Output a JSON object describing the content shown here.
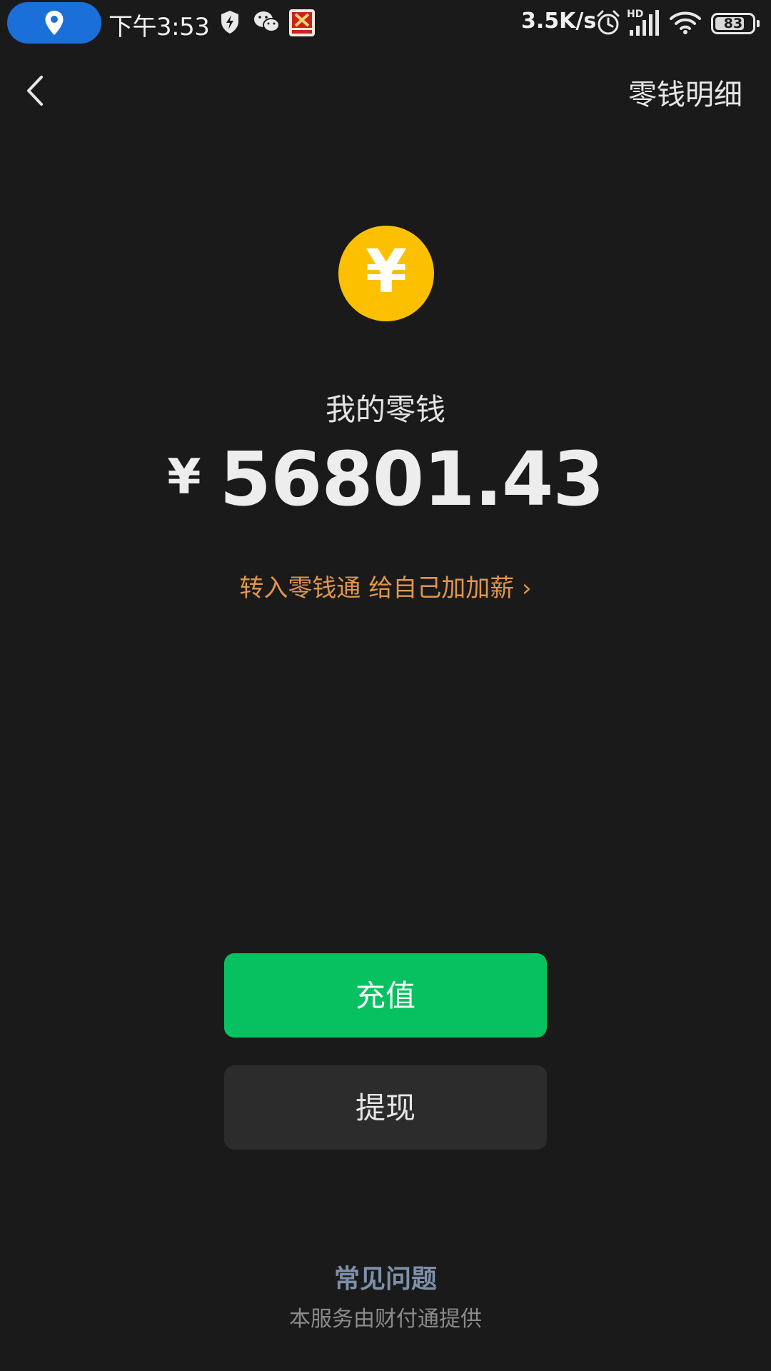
{
  "status_bar": {
    "time": "下午3:53",
    "network_speed": "3.5K/s",
    "signal_label": "HD",
    "battery": "83",
    "battery_level": 0.83,
    "icons": [
      "location-pin-icon",
      "shield-icon",
      "wechat-icon",
      "app-icon",
      "alarm-icon",
      "signal-icon",
      "wifi-icon",
      "battery-icon"
    ]
  },
  "nav": {
    "back_icon": "chevron-left-icon",
    "details_link": "零钱明细"
  },
  "wallet": {
    "coin_glyph": "¥",
    "label": "我的零钱",
    "currency": "¥",
    "amount": "56801.43",
    "promo": "转入零钱通 给自己加加薪 ›"
  },
  "actions": {
    "recharge": "充值",
    "withdraw": "提现"
  },
  "footer": {
    "faq": "常见问题",
    "provider": "本服务由财付通提供"
  },
  "colors": {
    "background": "#1a1a1a",
    "coin": "#fcc000",
    "primary_button": "#07c160",
    "secondary_button": "#2c2c2c",
    "promo_text": "#e0964c",
    "faq_link": "#7d90a9"
  }
}
